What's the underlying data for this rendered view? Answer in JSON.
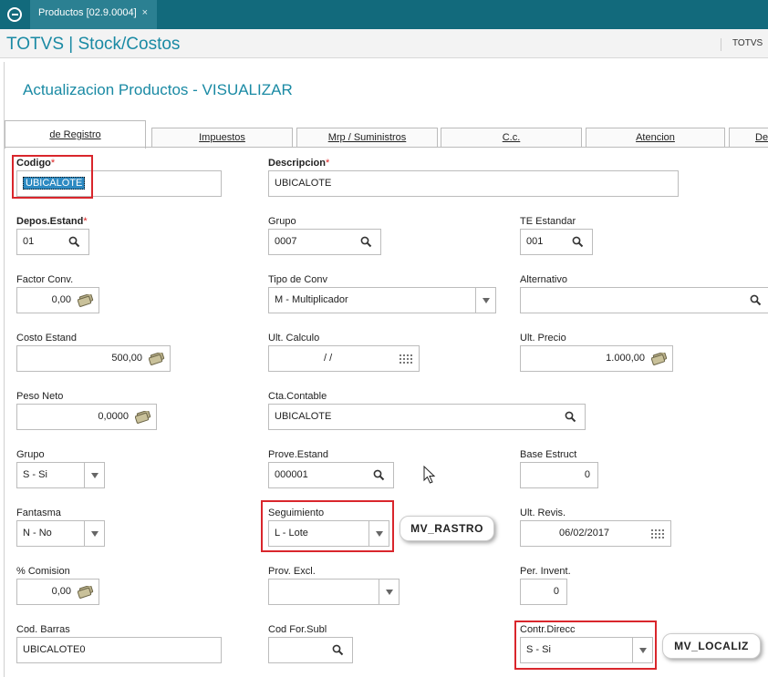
{
  "window": {
    "tab_title": "Productos [02.9.0004]",
    "close_glyph": "×"
  },
  "app": {
    "title": "TOTVS | Stock/Costos",
    "user": "TOTVS"
  },
  "page": {
    "title": "Actualizacion Productos - VISUALIZAR"
  },
  "tabs": [
    {
      "label": "de Registro",
      "active": true
    },
    {
      "label": "Impuestos",
      "active": false
    },
    {
      "label": "Mrp / Suministros",
      "active": false
    },
    {
      "label": "C.c.",
      "active": false
    },
    {
      "label": "Atencion",
      "active": false
    },
    {
      "label": "De",
      "active": false
    }
  ],
  "fields": {
    "codigo": {
      "label": "Codigo",
      "required": "*",
      "value": "UBICALOTE"
    },
    "descripcion": {
      "label": "Descripcion",
      "required": "*",
      "value": "UBICALOTE"
    },
    "depos_estand": {
      "label": "Depos.Estand",
      "required": "*",
      "value": "01"
    },
    "grupo": {
      "label": "Grupo",
      "value": "0007"
    },
    "te_estandar": {
      "label": "TE Estandar",
      "value": "001"
    },
    "factor_conv": {
      "label": "Factor Conv.",
      "value": "0,00"
    },
    "tipo_conv": {
      "label": "Tipo de Conv",
      "value": "M - Multiplicador"
    },
    "alternativo": {
      "label": "Alternativo",
      "value": ""
    },
    "costo_estand": {
      "label": "Costo Estand",
      "value": "500,00"
    },
    "ult_calculo": {
      "label": "Ult. Calculo",
      "value": "/ /"
    },
    "ult_precio": {
      "label": "Ult. Precio",
      "value": "1.000,00"
    },
    "peso_neto": {
      "label": "Peso Neto",
      "value": "0,0000"
    },
    "cta_contable": {
      "label": "Cta.Contable",
      "value": "UBICALOTE"
    },
    "grupo_sel": {
      "label": "Grupo",
      "value": "S - Si"
    },
    "prove_estand": {
      "label": "Prove.Estand",
      "value": "000001"
    },
    "base_estruct": {
      "label": "Base Estruct",
      "value": "0"
    },
    "fantasma": {
      "label": "Fantasma",
      "value": "N - No"
    },
    "seguimiento": {
      "label": "Seguimiento",
      "value": "L - Lote"
    },
    "ult_revis": {
      "label": "Ult. Revis.",
      "value": "06/02/2017"
    },
    "comision": {
      "label": "% Comision",
      "value": "0,00"
    },
    "prov_excl": {
      "label": "Prov. Excl.",
      "value": ""
    },
    "per_invent": {
      "label": "Per. Invent.",
      "value": "0"
    },
    "cod_barras": {
      "label": "Cod. Barras",
      "value": "UBICALOTE0"
    },
    "cod_for_subl": {
      "label": "Cod For.Subl",
      "value": ""
    },
    "contr_direcc": {
      "label": "Contr.Direcc",
      "value": "S - Si"
    }
  },
  "annotations": {
    "rastro": "MV_RASTRO",
    "localiz": "MV_LOCALIZ"
  },
  "colors": {
    "topbar": "#126a7c",
    "accent": "#1a8aa4",
    "highlight_box": "#d9262c",
    "selection": "#2d8ac2"
  },
  "icons": {
    "lookup": "search-icon",
    "money": "money-icon",
    "calendar": "calendar-icon",
    "dropdown": "chevron-down-icon",
    "logo": "totvs-logo-icon",
    "cursor": "mouse-cursor-icon"
  }
}
